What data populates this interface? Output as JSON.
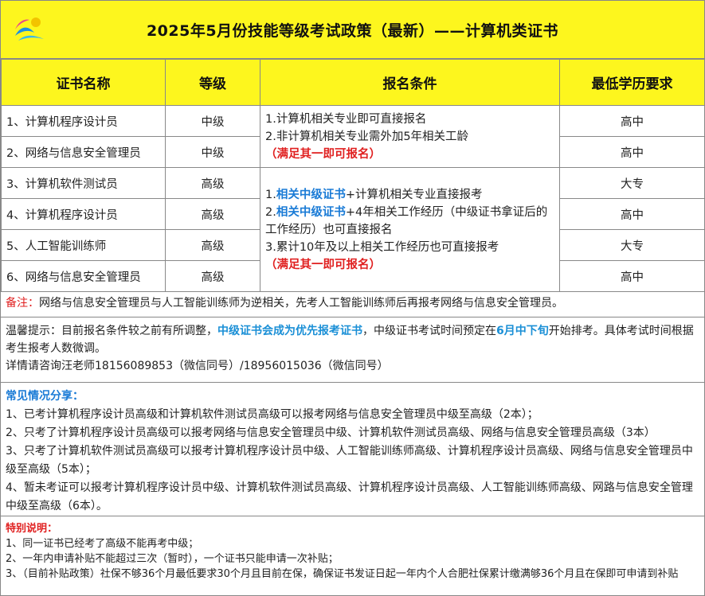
{
  "title": "2025年5月份技能等级考试政策（最新）——计算机类证书",
  "table": {
    "headers": [
      "证书名称",
      "等级",
      "报名条件",
      "最低学历要求"
    ],
    "rows": [
      {
        "name": "1、计算机程序设计员",
        "level": "中级",
        "edu": "高中"
      },
      {
        "name": "2、网络与信息安全管理员",
        "level": "中级",
        "edu": "高中"
      },
      {
        "name": "3、计算机软件测试员",
        "level": "高级",
        "edu": "大专"
      },
      {
        "name": "4、计算机程序设计员",
        "level": "高级",
        "edu": "高中"
      },
      {
        "name": "5、人工智能训练师",
        "level": "高级",
        "edu": "大专"
      },
      {
        "name": "6、网络与信息安全管理员",
        "level": "高级",
        "edu": "高中"
      }
    ],
    "cond_mid": {
      "line1": "1.计算机相关专业即可直接报名",
      "line2": "2.非计算机相关专业需外加5年相关工龄",
      "note": "（满足其一即可报名）"
    },
    "cond_high": {
      "l1_blue": "相关中级证书",
      "l1_prefix": "1.",
      "l1_rest": "+计算机相关专业直接报考",
      "l2_prefix": "2.",
      "l2_blue": "相关中级证书",
      "l2_rest": "+4年相关工作经历（中级证书拿证后的工作经历）也可直接报名",
      "l3": "3.累计10年及以上相关工作经历也可直接报考",
      "note": "（满足其一即可报名）"
    }
  },
  "note": {
    "label": "备注：",
    "text": "网络与信息安全管理员与人工智能训练师为逆相关，先考人工智能训练师后再报考网络与信息安全管理员。"
  },
  "tip": {
    "p1": "温馨提示：目前报名条件较之前有所调整，",
    "highlight1": "中级证书会成为优先报考证书",
    "p2": "，中级证书考试时间预定在",
    "highlight2": "6月中下旬",
    "p3": "开始排考。具体考试时间根据考生报考人数微调。",
    "contact": "详情请咨询汪老师18156089853（微信同号）/18956015036（微信同号）"
  },
  "share": {
    "head": "常见情况分享：",
    "items": [
      "1、已考计算机程序设计员高级和计算机软件测试员高级可以报考网络与信息安全管理员中级至高级（2本）；",
      "2、只考了计算机程序设计员高级可以报考网络与信息安全管理员中级、计算机软件测试员高级、网络与信息安全管理员高级（3本）",
      "3、只考了计算机软件测试员高级可以报考计算机程序设计员中级、人工智能训练师高级、计算机程序设计员高级、网络与信息安全管理员中级至高级（5本）；",
      "4、暂未考证可以报考计算机程序设计员中级、计算机软件测试员高级、计算机程序设计员高级、人工智能训练师高级、网路与信息安全管理中级至高级（6本）。"
    ]
  },
  "special": {
    "head": "特别说明：",
    "items": [
      "1、同一证书已经考了高级不能再考中级；",
      "2、一年内申请补贴不能超过三次（暂时），一个证书只能申请一次补贴；",
      "3、（目前补贴政策）社保不够36个月最低要求30个月且目前在保，确保证书发证日起一年内个人合肥社保累计缴满够36个月且在保即可申请到补贴"
    ]
  },
  "colors": {
    "yellow": "#fdf61e",
    "red": "#e02020",
    "blue": "#1a7bd6"
  },
  "logo_icon": "wave-sun-logo-icon"
}
